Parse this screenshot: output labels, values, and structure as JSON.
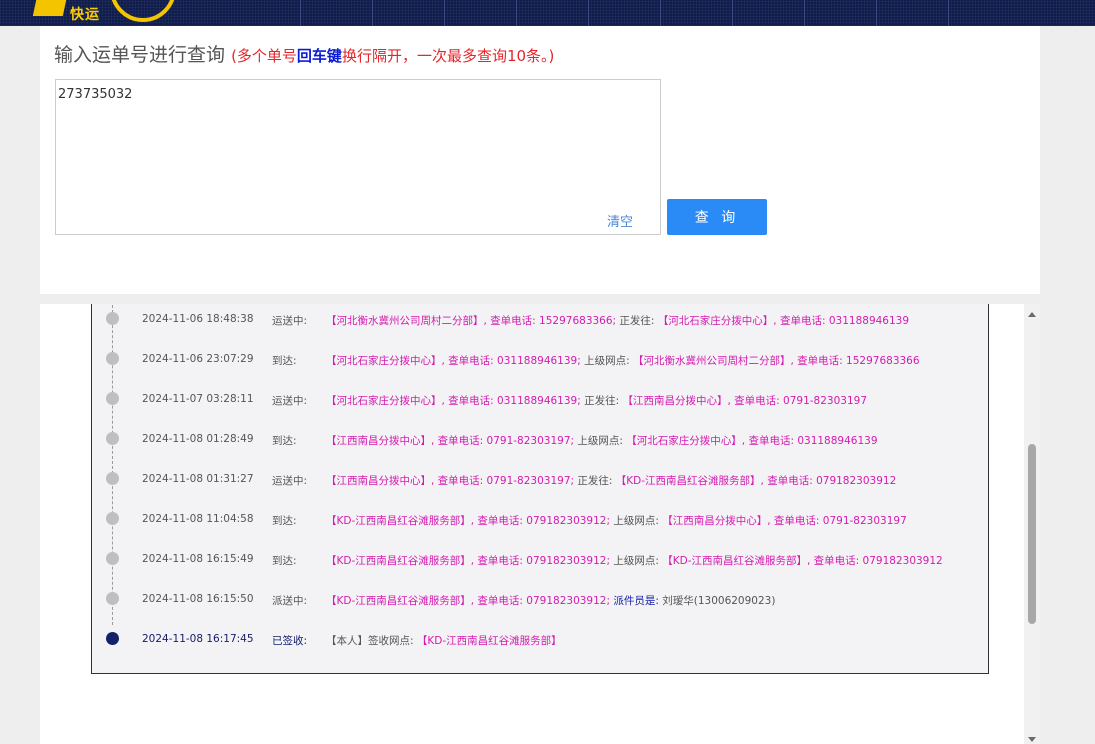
{
  "header": {
    "logo_text": "快运"
  },
  "query": {
    "title": "输入运单号进行查询",
    "hint_prefix": "(多个单号",
    "hint_key": "回车键",
    "hint_suffix": "换行隔开，一次最多查询10条。)",
    "input_value": "273735032",
    "clear_label": "清空",
    "submit_label": "查 询"
  },
  "tracking": [
    {
      "time": "2024-11-06 18:48:38",
      "status": "运送中:",
      "a": "【河北衡水冀州公司周村二分部】, 查单电话: 15297683366;",
      "mid": "正发往:",
      "b": "【河北石家庄分拨中心】, 查单电话: 031188946139"
    },
    {
      "time": "2024-11-06 23:07:29",
      "status": "到达:",
      "a": "【河北石家庄分拨中心】, 查单电话: 031188946139;",
      "mid": "上级网点:",
      "b": "【河北衡水冀州公司周村二分部】, 查单电话: 15297683366"
    },
    {
      "time": "2024-11-07 03:28:11",
      "status": "运送中:",
      "a": "【河北石家庄分拨中心】, 查单电话: 031188946139;",
      "mid": "正发往:",
      "b": "【江西南昌分拨中心】, 查单电话: 0791-82303197"
    },
    {
      "time": "2024-11-08 01:28:49",
      "status": "到达:",
      "a": "【江西南昌分拨中心】, 查单电话: 0791-82303197;",
      "mid": "上级网点:",
      "b": "【河北石家庄分拨中心】, 查单电话: 031188946139"
    },
    {
      "time": "2024-11-08 01:31:27",
      "status": "运送中:",
      "a": "【江西南昌分拨中心】, 查单电话: 0791-82303197;",
      "mid": "正发往:",
      "b": "【KD-江西南昌红谷滩服务部】, 查单电话: 079182303912"
    },
    {
      "time": "2024-11-08 11:04:58",
      "status": "到达:",
      "a": "【KD-江西南昌红谷滩服务部】, 查单电话: 079182303912;",
      "mid": "上级网点:",
      "b": "【江西南昌分拨中心】, 查单电话: 0791-82303197"
    },
    {
      "time": "2024-11-08 16:15:49",
      "status": "到达:",
      "a": "【KD-江西南昌红谷滩服务部】, 查单电话: 079182303912;",
      "mid": "上级网点:",
      "b": "【KD-江西南昌红谷滩服务部】, 查单电话: 079182303912"
    },
    {
      "time": "2024-11-08 16:15:50",
      "status": "派送中:",
      "a": "【KD-江西南昌红谷滩服务部】, 查单电话: 079182303912;",
      "mid": "派件员是:",
      "b": "刘瑷华(13006209023)"
    },
    {
      "time": "2024-11-08 16:17:45",
      "status": "已签收:",
      "a": "【本人】签收网点:",
      "mid": "",
      "b": "【KD-江西南昌红谷滩服务部】"
    }
  ]
}
